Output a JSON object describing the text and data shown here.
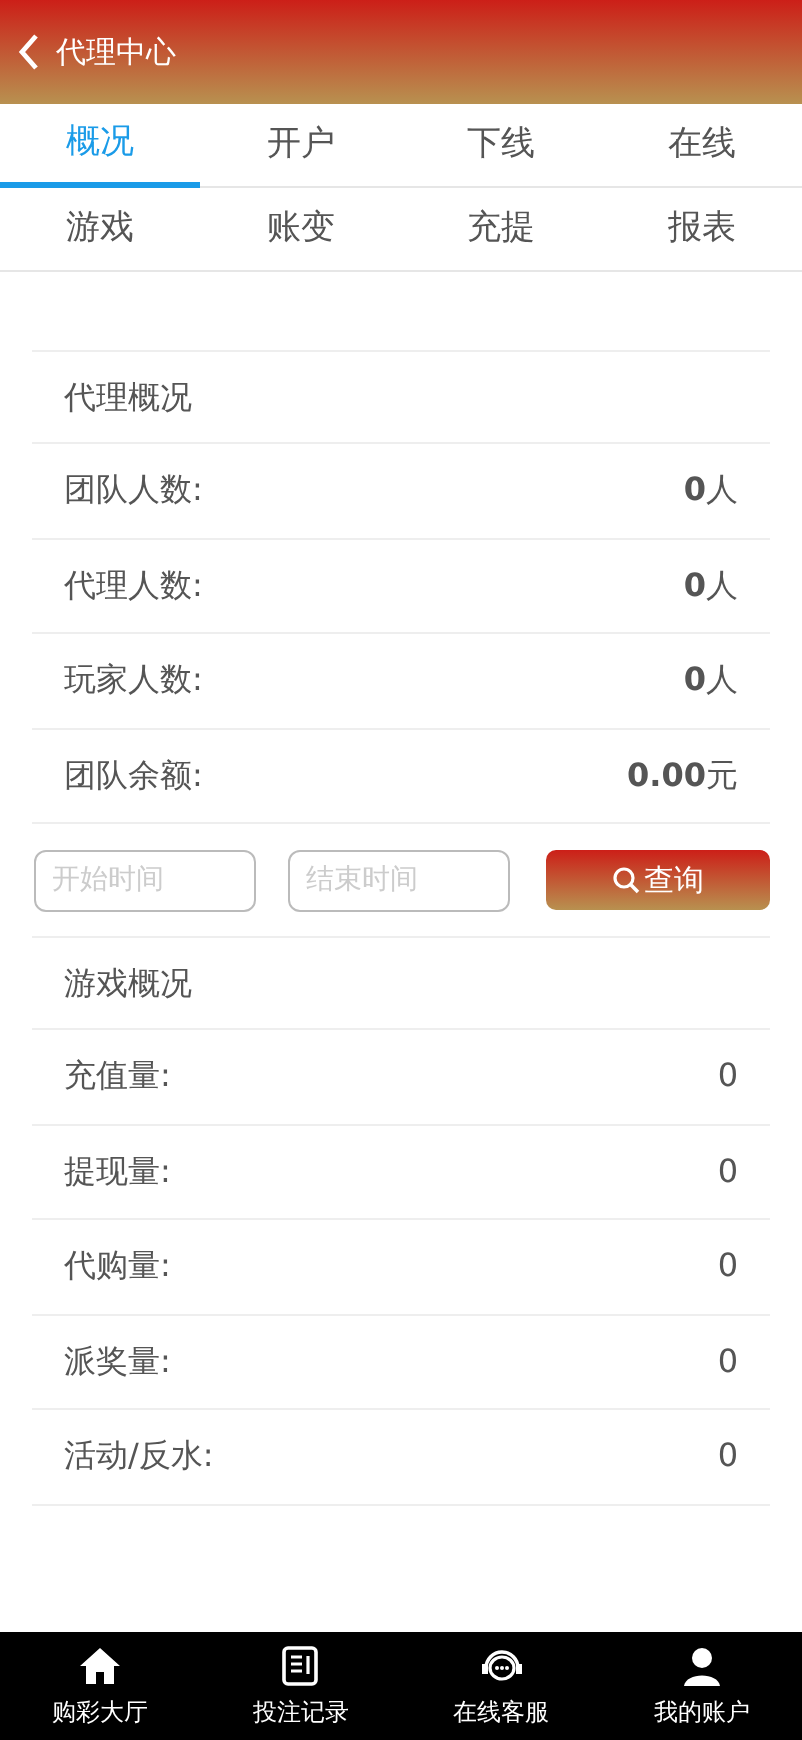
{
  "header": {
    "title": "代理中心"
  },
  "tabs": [
    {
      "label": "概况",
      "selected": true
    },
    {
      "label": "开户",
      "selected": false
    },
    {
      "label": "下线",
      "selected": false
    },
    {
      "label": "在线",
      "selected": false
    },
    {
      "label": "游戏",
      "selected": false
    },
    {
      "label": "账变",
      "selected": false
    },
    {
      "label": "充提",
      "selected": false
    },
    {
      "label": "报表",
      "selected": false
    }
  ],
  "agent_overview": {
    "title": "代理概况",
    "rows": [
      {
        "label": "团队人数:",
        "value": "**0**人"
      },
      {
        "label": "代理人数:",
        "value": "**0**人"
      },
      {
        "label": "玩家人数:",
        "value": "**0**人"
      },
      {
        "label": "团队余额:",
        "value": "**0.00**元"
      }
    ]
  },
  "filter": {
    "start": {
      "placeholder": "开始时间"
    },
    "end": {
      "placeholder": "结束时间"
    },
    "button": "查询"
  },
  "game_overview": {
    "title": "游戏概况",
    "rows": [
      {
        "label": "充值量:",
        "value": "0"
      },
      {
        "label": "提现量:",
        "value": "0"
      },
      {
        "label": "代购量:",
        "value": "0"
      },
      {
        "label": "派奖量:",
        "value": "0"
      },
      {
        "label": "活动/反水:",
        "value": "0"
      }
    ]
  },
  "bottom_nav": [
    {
      "kind": "home",
      "label": "购彩大厅"
    },
    {
      "kind": "record",
      "label": "投注记录"
    },
    {
      "kind": "support",
      "label": "在线客服"
    },
    {
      "kind": "user",
      "label": "我的账户"
    }
  ]
}
